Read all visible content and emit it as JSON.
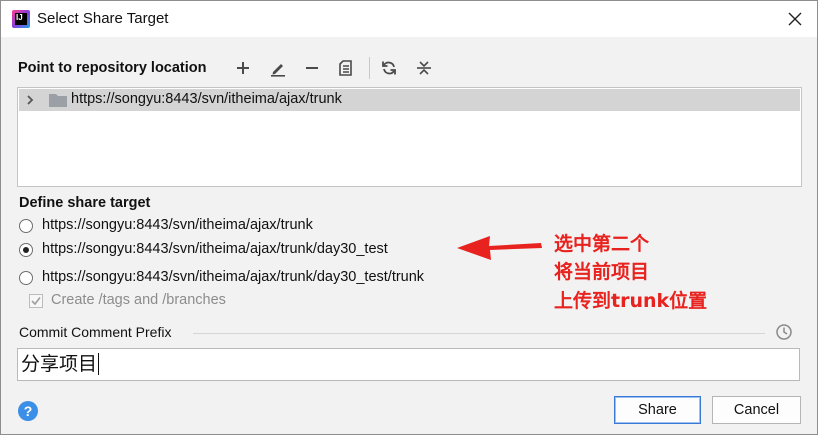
{
  "window": {
    "title": "Select Share Target"
  },
  "repository": {
    "section_label": "Point to repository location",
    "items": [
      {
        "url": "https://songyu:8443/svn/itheima/ajax/trunk"
      }
    ]
  },
  "toolbar": {
    "icons": [
      "add-icon",
      "edit-icon",
      "remove-icon",
      "browse-icon",
      "refresh-icon",
      "collapse-icon"
    ]
  },
  "share_target": {
    "section_label": "Define share target",
    "options": [
      {
        "label": "https://songyu:8443/svn/itheima/ajax/trunk",
        "selected": false
      },
      {
        "label": "https://songyu:8443/svn/itheima/ajax/trunk/day30_test",
        "selected": true
      },
      {
        "label": "https://songyu:8443/svn/itheima/ajax/trunk/day30_test/trunk",
        "selected": false
      }
    ],
    "create_tags_label": "Create /tags and /branches",
    "create_tags_checked": true,
    "create_tags_enabled": false
  },
  "commit": {
    "prefix_label": "Commit Comment Prefix",
    "value": "分享项目"
  },
  "buttons": {
    "share": "Share",
    "cancel": "Cancel"
  },
  "help": {
    "glyph": "?"
  },
  "annotation": {
    "lines": [
      "选中第二个",
      "将当前项目",
      "上传到trunk位置"
    ],
    "color": "#e8231f"
  },
  "colors": {
    "selected_row": "#d4d4d4",
    "primary_border": "#3a78d6",
    "help_blue": "#3b8fe6"
  }
}
